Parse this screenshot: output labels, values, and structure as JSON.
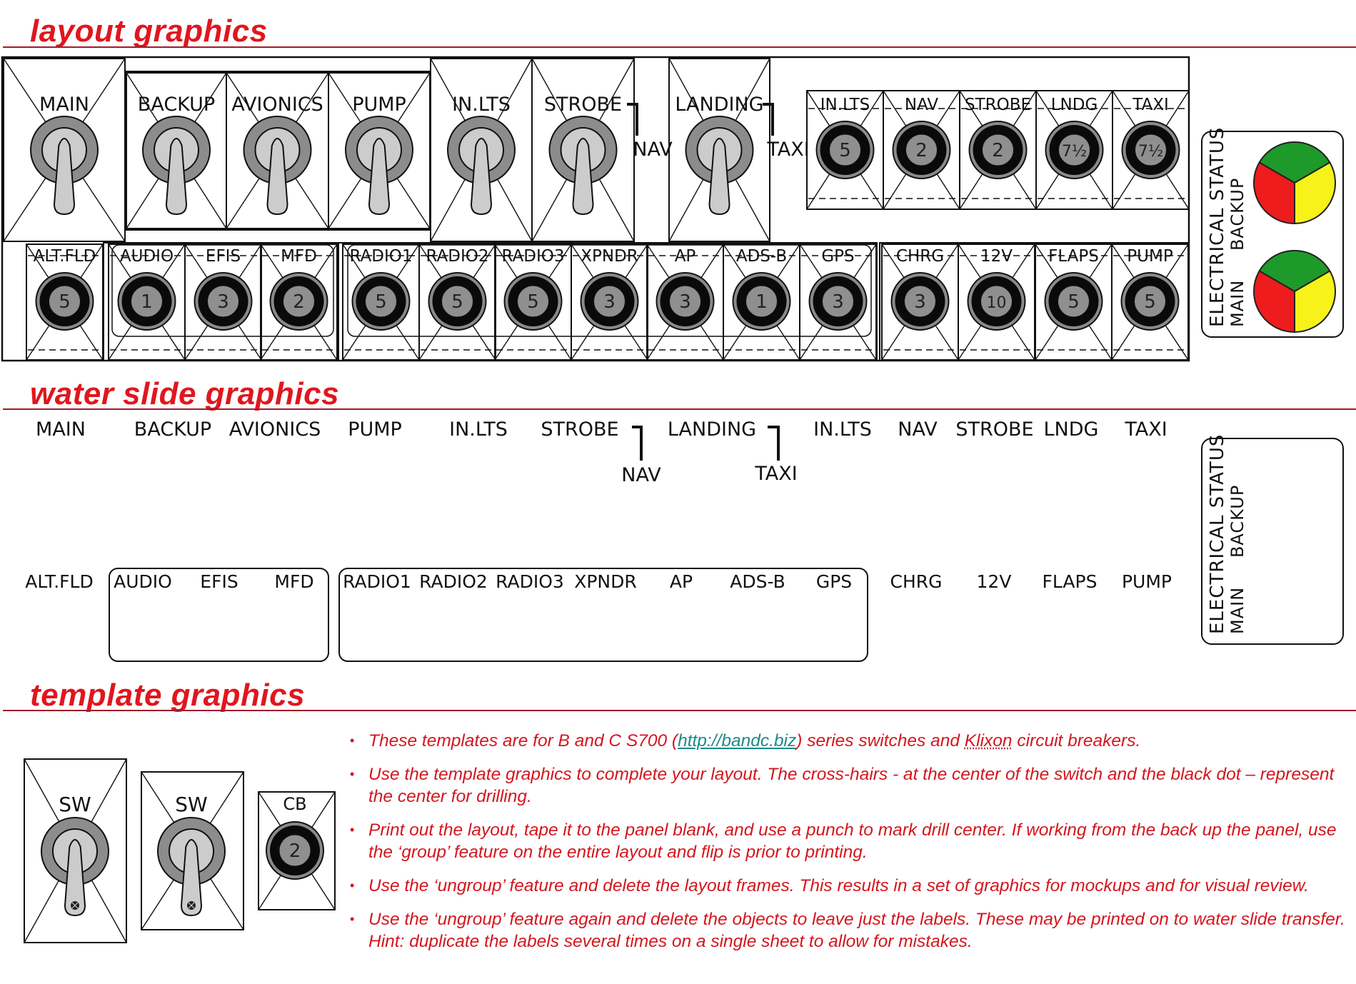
{
  "sections": {
    "layout_title": "layout graphics",
    "water_slide_title": "water slide graphics",
    "template_title": "template graphics"
  },
  "colors": {
    "title_red": "#e0161e",
    "rule": "#a01a2a",
    "switch_outer": "#8c8c8c",
    "switch_inner": "#cccccc",
    "cb_ring": "#8a8a8a",
    "cb_body": "#0a0a0a",
    "cb_face": "#8f8f8f",
    "status_green": "#1e9a2a",
    "status_red": "#ee1c1c",
    "status_yellow": "#f6f21a",
    "link": "#1a8a8a",
    "instruction_text": "#d4161e"
  },
  "layout": {
    "switches": [
      {
        "label": "MAIN"
      },
      {
        "label": "BACKUP"
      },
      {
        "label": "AVIONICS"
      },
      {
        "label": "PUMP"
      },
      {
        "label": "IN.LTS"
      },
      {
        "label": "STROBE",
        "sub_label": "NAV"
      },
      {
        "label": "LANDING",
        "sub_label": "TAXI"
      }
    ],
    "top_breakers": [
      {
        "label": "IN.LTS",
        "rating": "5"
      },
      {
        "label": "NAV",
        "rating": "2"
      },
      {
        "label": "STROBE",
        "rating": "2"
      },
      {
        "label": "LNDG",
        "rating": "7½"
      },
      {
        "label": "TAXI",
        "rating": "7½"
      }
    ],
    "bottom_breakers": [
      {
        "label": "ALT.FLD",
        "rating": "5"
      },
      {
        "label": "AUDIO",
        "rating": "1"
      },
      {
        "label": "EFIS",
        "rating": "3"
      },
      {
        "label": "MFD",
        "rating": "2"
      },
      {
        "label": "RADIO1",
        "rating": "5"
      },
      {
        "label": "RADIO2",
        "rating": "5"
      },
      {
        "label": "RADIO3",
        "rating": "5"
      },
      {
        "label": "XPNDR",
        "rating": "3"
      },
      {
        "label": "AP",
        "rating": "3"
      },
      {
        "label": "ADS-B",
        "rating": "1"
      },
      {
        "label": "GPS",
        "rating": "3"
      },
      {
        "label": "CHRG",
        "rating": "3"
      },
      {
        "label": "12V",
        "rating": "10"
      },
      {
        "label": "FLAPS",
        "rating": "5"
      },
      {
        "label": "PUMP",
        "rating": "5"
      }
    ],
    "status": {
      "title": "ELECTRICAL STATUS",
      "backup_label": "BACKUP",
      "main_label": "MAIN"
    }
  },
  "water_slide": {
    "top_labels": [
      "MAIN",
      "BACKUP",
      "AVIONICS",
      "PUMP",
      "IN.LTS",
      "STROBE",
      "LANDING",
      "IN.LTS",
      "NAV",
      "STROBE",
      "LNDG",
      "TAXI"
    ],
    "sub_labels": [
      "NAV",
      "TAXI"
    ],
    "bottom_labels": [
      "ALT.FLD",
      "AUDIO",
      "EFIS",
      "MFD",
      "RADIO1",
      "RADIO2",
      "RADIO3",
      "XPNDR",
      "AP",
      "ADS-B",
      "GPS",
      "CHRG",
      "12V",
      "FLAPS",
      "PUMP"
    ],
    "status": {
      "title": "ELECTRICAL STATUS",
      "backup_label": "BACKUP",
      "main_label": "MAIN"
    }
  },
  "template": {
    "items": [
      {
        "label": "SW"
      },
      {
        "label": "SW"
      },
      {
        "label": "CB",
        "rating": "2"
      }
    ]
  },
  "instructions": [
    {
      "parts": [
        {
          "text": "These templates are for B and C S700 ("
        },
        {
          "text": "http://bandc.biz",
          "type": "link"
        },
        {
          "text": ") series switches and "
        },
        {
          "text": "Klixon",
          "type": "spell"
        },
        {
          "text": " circuit breakers."
        }
      ]
    },
    {
      "parts": [
        {
          "text": "Use the template graphics to complete your layout. The cross-hairs -  at the center of the switch and the black dot – represent the center for drilling."
        }
      ]
    },
    {
      "parts": [
        {
          "text": "Print out the layout, tape it to the panel blank, and use a punch to mark drill center. If working from the back up the panel, use the ‘group’ feature on the entire layout and flip is prior to printing."
        }
      ]
    },
    {
      "parts": [
        {
          "text": "Use the ‘ungroup’ feature and delete the layout frames. This results in a set of graphics for mockups and for visual review."
        }
      ]
    },
    {
      "parts": [
        {
          "text": "Use the ‘ungroup’ feature again and delete the objects to leave just the labels. These may be printed on to water slide transfer. Hint: duplicate the labels several times on a single sheet to allow for mistakes."
        }
      ]
    }
  ]
}
